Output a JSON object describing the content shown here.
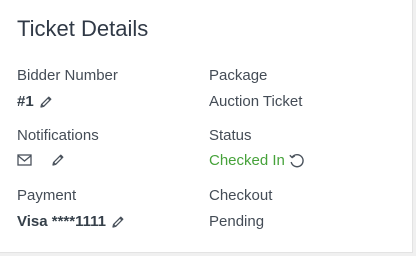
{
  "title": "Ticket Details",
  "bidder": {
    "label": "Bidder Number",
    "value": "#1",
    "edit_icon": "pencil-icon"
  },
  "package": {
    "label": "Package",
    "value": "Auction Ticket"
  },
  "notifications": {
    "label": "Notifications",
    "mail_icon": "envelope-icon",
    "edit_icon": "pencil-icon"
  },
  "status": {
    "label": "Status",
    "value": "Checked In",
    "reset_icon": "undo-icon",
    "color": "#46a23a"
  },
  "payment": {
    "label": "Payment",
    "value": "Visa ****1111",
    "edit_icon": "pencil-icon"
  },
  "checkout": {
    "label": "Checkout",
    "value": "Pending"
  }
}
